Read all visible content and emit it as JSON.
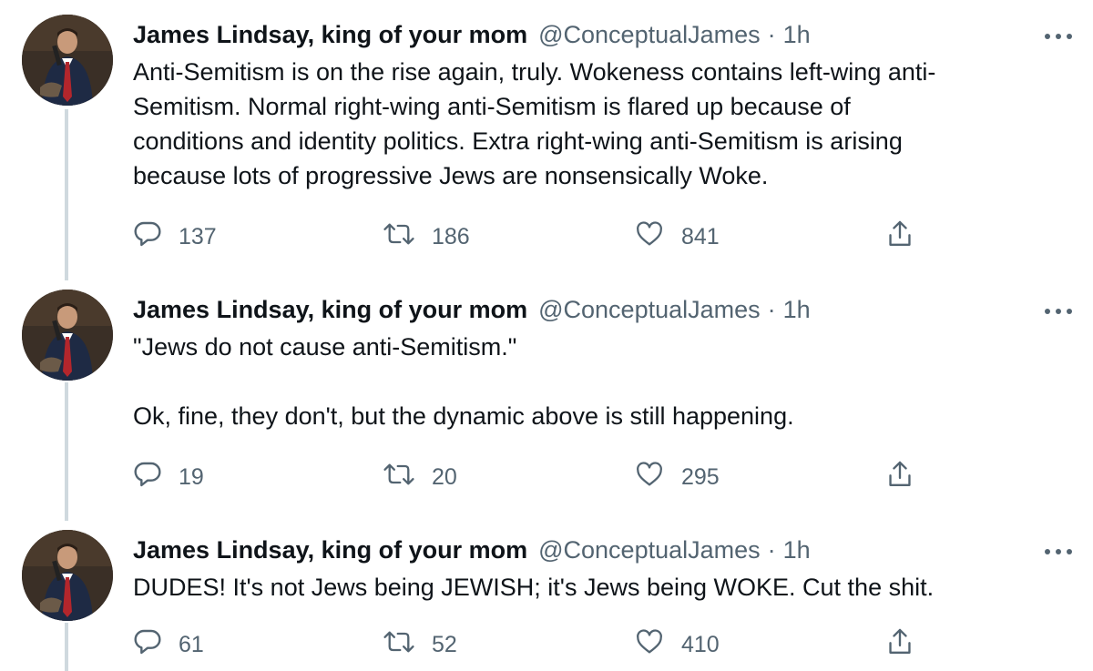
{
  "tweets": [
    {
      "display_name": "James Lindsay, king of your mom",
      "handle": "@ConceptualJames",
      "separator": "·",
      "time": "1h",
      "text": "Anti-Semitism is on the rise again, truly. Wokeness contains left-wing anti-\nSemitism. Normal right-wing anti-Semitism is flared up because of\nconditions and identity politics. Extra right-wing anti-Semitism is arising\nbecause lots of progressive Jews are nonsensically Woke.",
      "replies": "137",
      "retweets": "186",
      "likes": "841"
    },
    {
      "display_name": "James Lindsay, king of your mom",
      "handle": "@ConceptualJames",
      "separator": "·",
      "time": "1h",
      "text": "\"Jews do not cause anti-Semitism.\"\n\nOk, fine, they don't, but the dynamic above is still happening.",
      "replies": "19",
      "retweets": "20",
      "likes": "295"
    },
    {
      "display_name": "James Lindsay, king of your mom",
      "handle": "@ConceptualJames",
      "separator": "·",
      "time": "1h",
      "text": "DUDES! It's not Jews being JEWISH; it's Jews being WOKE. Cut the shit.",
      "replies": "61",
      "retweets": "52",
      "likes": "410"
    }
  ],
  "icons": {
    "reply": "reply-icon",
    "retweet": "retweet-icon",
    "like": "heart-icon",
    "share": "share-icon",
    "more": "more-icon"
  },
  "colors": {
    "text": "#0f1419",
    "secondary": "#536471",
    "thread_line": "#cfd9de"
  }
}
